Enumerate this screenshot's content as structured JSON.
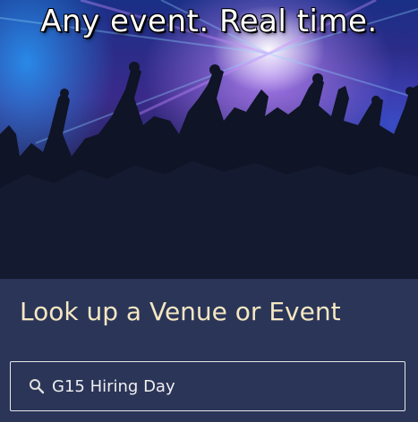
{
  "hero": {
    "headline": "Any event. Real time."
  },
  "panel": {
    "title": "Look up a Venue or Event",
    "search": {
      "value": "G15 Hiring Day",
      "icon": "search-icon"
    }
  },
  "colors": {
    "panel_bg": "#2a3558",
    "title_color": "#f4e7c2",
    "input_border": "#e8e8e8"
  }
}
